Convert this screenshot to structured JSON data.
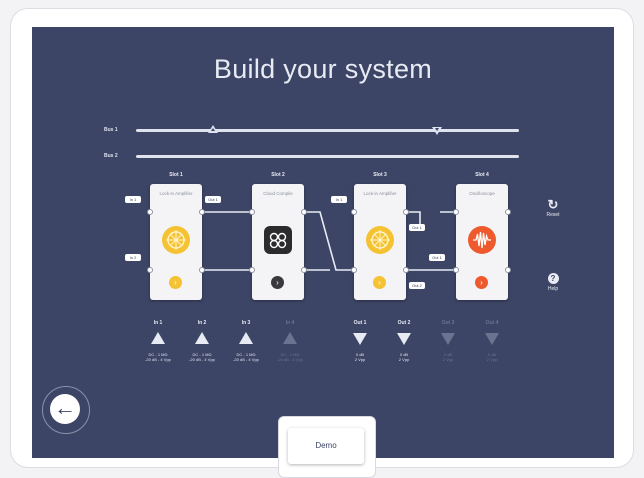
{
  "title": "Build your system",
  "buses": [
    {
      "label": "Bus 1"
    },
    {
      "label": "Bus 2"
    }
  ],
  "slots": [
    {
      "label": "Slot 1",
      "name": "Lock-in Amplifier",
      "color": "#f4c233"
    },
    {
      "label": "Slot 2",
      "name": "Cloud Compile",
      "color": "#2b2b2e"
    },
    {
      "label": "Slot 3",
      "name": "Lock-in Amplifier",
      "color": "#f4c233"
    },
    {
      "label": "Slot 4",
      "name": "Oscilloscope",
      "color": "#ee5a2d"
    }
  ],
  "tags": {
    "t1": "In 1",
    "t2": "In 2",
    "t3": "Out 1",
    "t4": "In 1",
    "t5": "Out 1",
    "t6": "Out 2",
    "t7": "Out 1"
  },
  "inputs": [
    {
      "label": "In 1",
      "spec": "DC - 1 MΩ\n-20 dB - 4 Vpp",
      "active": true
    },
    {
      "label": "In 2",
      "spec": "DC - 1 MΩ\n-20 dB - 4 Vpp",
      "active": true
    },
    {
      "label": "In 3",
      "spec": "DC - 1 MΩ\n-20 dB - 4 Vpp",
      "active": true
    },
    {
      "label": "In 4",
      "spec": "DC - 1 MΩ\n-20 dB - 4 Vpp",
      "active": false
    }
  ],
  "outputs": [
    {
      "label": "Out 1",
      "spec": "0 dB\n2 Vpp",
      "active": true
    },
    {
      "label": "Out 2",
      "spec": "0 dB\n2 Vpp",
      "active": true
    },
    {
      "label": "Out 3",
      "spec": "0 dB\n2 Vpp",
      "active": false
    },
    {
      "label": "Out 4",
      "spec": "0 dB\n2 Vpp",
      "active": false
    }
  ],
  "side": {
    "reset": "Reset",
    "help": "Help",
    "help_glyph": "?"
  },
  "demo": "Demo",
  "back_glyph": "←",
  "reset_glyph": "↻",
  "go_glyph": "›",
  "colors": {
    "background": "#3d4566",
    "accent": "#f4c233",
    "scope": "#ee5a2d"
  }
}
